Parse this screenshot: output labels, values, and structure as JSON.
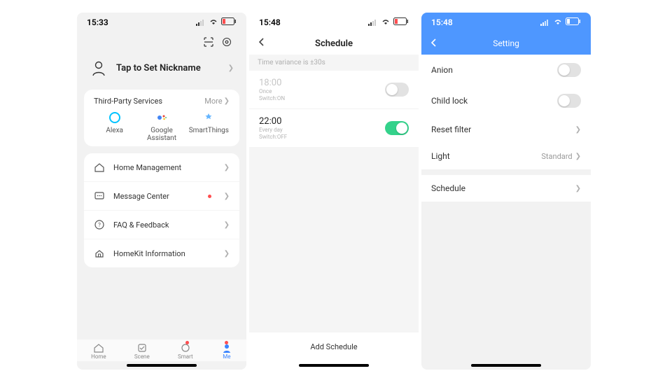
{
  "phone1": {
    "time": "15:33",
    "nickname": "Tap to Set Nickname",
    "tp_header": "Third-Party Services",
    "tp_more": "More",
    "tp_items": [
      {
        "label": "Alexa"
      },
      {
        "label": "Google Assistant"
      },
      {
        "label": "SmartThings"
      }
    ],
    "menu": [
      {
        "label": "Home Management"
      },
      {
        "label": "Message Center"
      },
      {
        "label": "FAQ & Feedback"
      },
      {
        "label": "HomeKit Information"
      }
    ],
    "tabs": [
      {
        "label": "Home"
      },
      {
        "label": "Scene"
      },
      {
        "label": "Smart"
      },
      {
        "label": "Me"
      }
    ]
  },
  "phone2": {
    "time": "15:48",
    "title": "Schedule",
    "variance": "Time variance is  ±30s",
    "schedules": [
      {
        "time": "18:00",
        "repeat": "Once",
        "action": "Switch:ON",
        "on": false,
        "disabled": true
      },
      {
        "time": "22:00",
        "repeat": "Every day",
        "action": "Switch:OFF",
        "on": true,
        "disabled": false
      }
    ],
    "add": "Add Schedule"
  },
  "phone3": {
    "time": "15:48",
    "title": "Setting",
    "rows": {
      "anion": "Anion",
      "child_lock": "Child lock",
      "reset_filter": "Reset filter",
      "light": "Light",
      "light_value": "Standard",
      "schedule": "Schedule"
    }
  }
}
